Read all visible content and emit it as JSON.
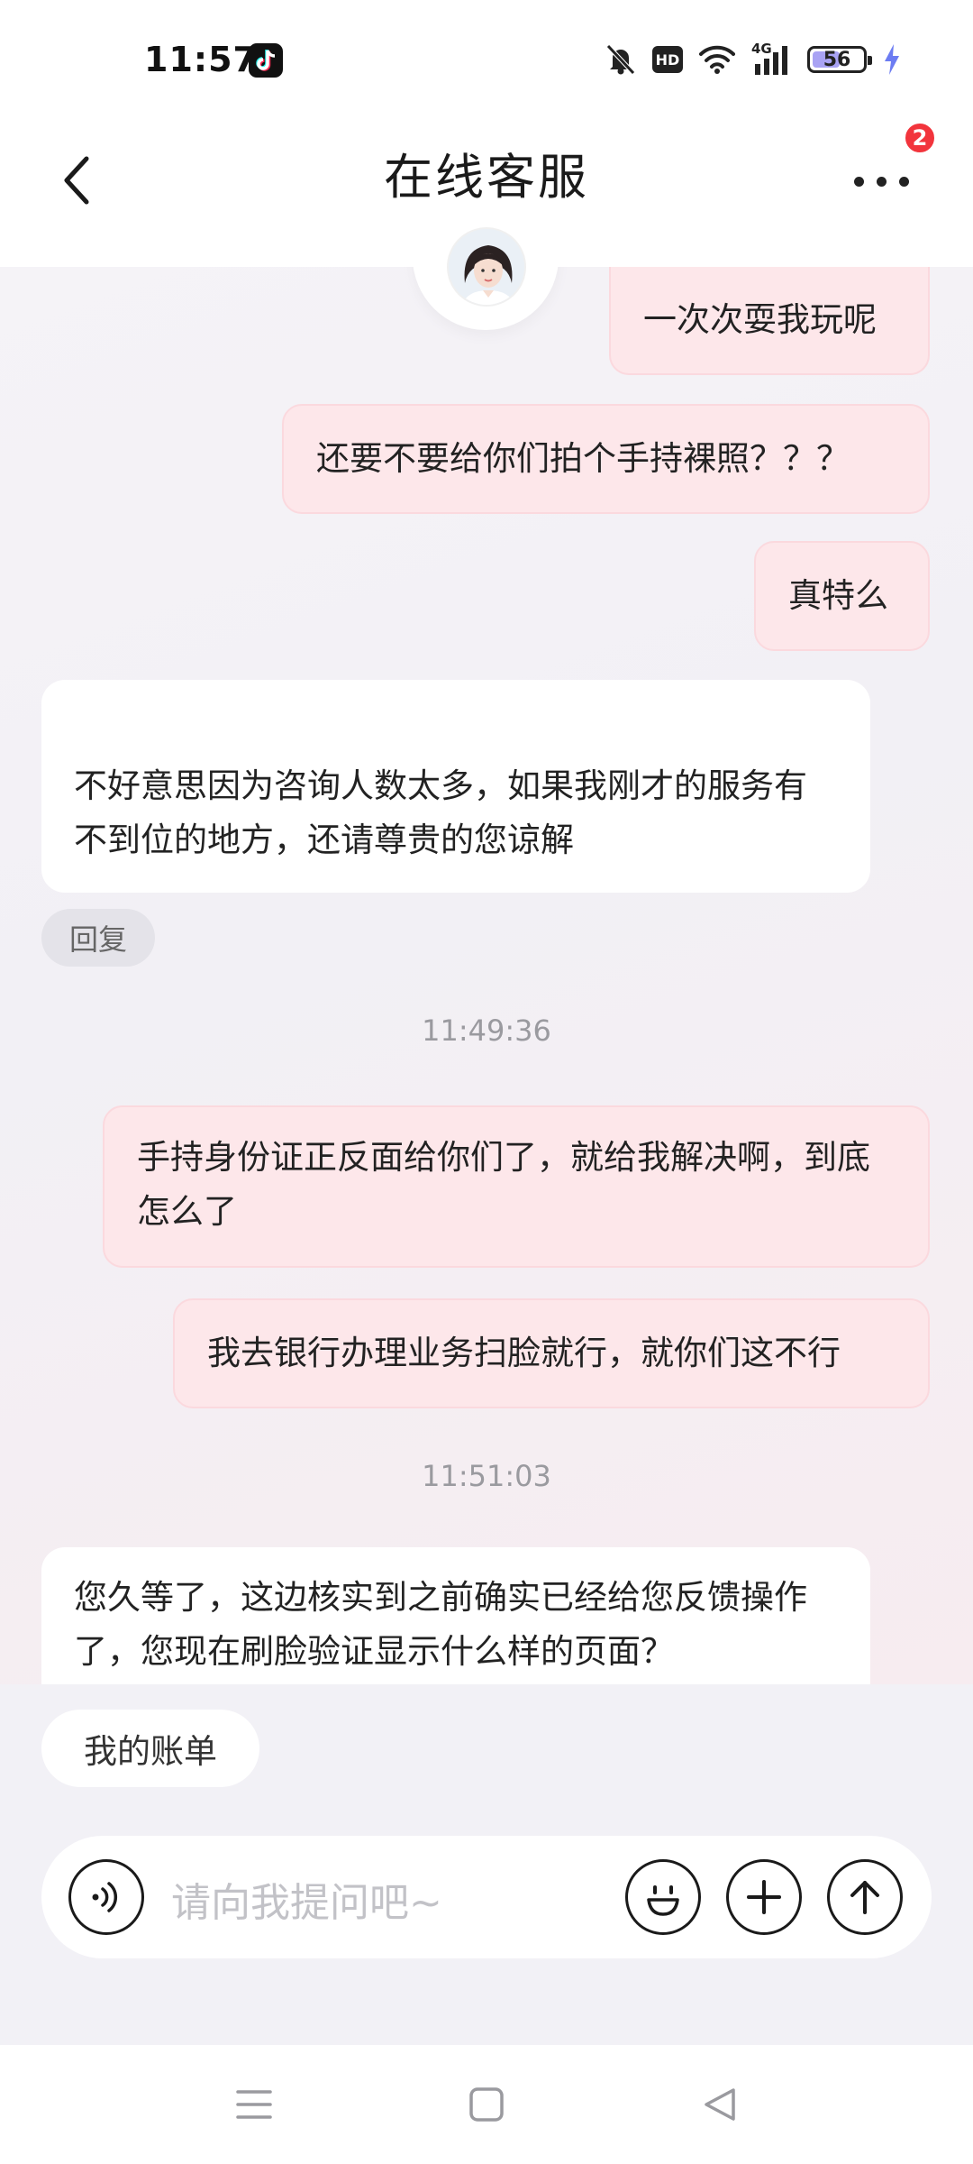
{
  "status_bar": {
    "time": "11:57",
    "battery": "56",
    "battery_level": 0.56,
    "network": "4G",
    "hd": "HD"
  },
  "nav": {
    "title": "在线客服",
    "badge_count": "2"
  },
  "messages": [
    {
      "side": "user",
      "text": "一次次耍我玩呢"
    },
    {
      "side": "user",
      "text": "还要不要给你们拍个手持裸照？？？"
    },
    {
      "side": "user",
      "text": "真特么"
    },
    {
      "side": "agent",
      "text": "不好意思因为咨询人数太多，如果我刚才的服务有不到位的地方，还请尊贵的您谅解"
    },
    {
      "side": "timestamp",
      "text": "11:49:36"
    },
    {
      "side": "user",
      "text": "手持身份证正反面给你们了，就给我解决啊，到底怎么了"
    },
    {
      "side": "user",
      "text": "我去银行办理业务扫脸就行，就你们这不行"
    },
    {
      "side": "timestamp",
      "text": "11:51:03"
    },
    {
      "side": "agent",
      "text": "您久等了，这边核实到之前确实已经给您反馈操作了，您现在刷脸验证显示什么样的页面？"
    }
  ],
  "reply_chip": "回复",
  "quick_reply": "我的账单",
  "input": {
    "placeholder": "请向我提问吧~"
  },
  "icons": {
    "back": "chevron-left-icon",
    "more": "more-dots-icon",
    "voice": "voice-icon",
    "emoji": "emoji-icon",
    "add": "plus-icon",
    "send": "arrow-up-icon"
  },
  "colors": {
    "user_bubble": "#fde7ea",
    "agent_bubble": "#ffffff",
    "badge": "#f2343c"
  }
}
